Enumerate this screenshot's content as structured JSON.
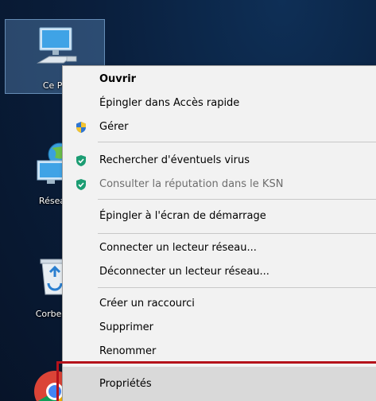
{
  "desktop": {
    "icons": [
      {
        "label": "Ce PC",
        "icon": "monitor-icon",
        "selected": true
      },
      {
        "label": "Réseau",
        "icon": "network-globe-icon",
        "selected": false
      },
      {
        "label": "Corbeille",
        "icon": "recycle-bin-icon",
        "selected": false
      },
      {
        "label": "",
        "icon": "chrome-icon",
        "selected": false
      }
    ]
  },
  "context_menu": {
    "items": [
      {
        "label": "Ouvrir",
        "bold": true,
        "icon": null,
        "disabled": false
      },
      {
        "label": "Épingler dans Accès rapide",
        "bold": false,
        "icon": null,
        "disabled": false
      },
      {
        "label": "Gérer",
        "bold": false,
        "icon": "uac-shield-icon",
        "disabled": false
      },
      {
        "label": "Rechercher d'éventuels virus",
        "bold": false,
        "icon": "kaspersky-shield-icon",
        "disabled": false
      },
      {
        "label": "Consulter la réputation dans le KSN",
        "bold": false,
        "icon": "kaspersky-shield-icon",
        "disabled": true
      },
      {
        "label": "Épingler à l'écran de démarrage",
        "bold": false,
        "icon": null,
        "disabled": false
      },
      {
        "label": "Connecter un lecteur réseau...",
        "bold": false,
        "icon": null,
        "disabled": false
      },
      {
        "label": "Déconnecter un lecteur réseau...",
        "bold": false,
        "icon": null,
        "disabled": false
      },
      {
        "label": "Créer un raccourci",
        "bold": false,
        "icon": null,
        "disabled": false
      },
      {
        "label": "Supprimer",
        "bold": false,
        "icon": null,
        "disabled": false
      },
      {
        "label": "Renommer",
        "bold": false,
        "icon": null,
        "disabled": false
      },
      {
        "label": "Propriétés",
        "bold": false,
        "icon": null,
        "disabled": false,
        "highlighted": true
      }
    ]
  },
  "colors": {
    "highlight_border": "#b5121b",
    "kaspersky_green": "#1c9d73",
    "menu_background": "#f2f2f2"
  }
}
